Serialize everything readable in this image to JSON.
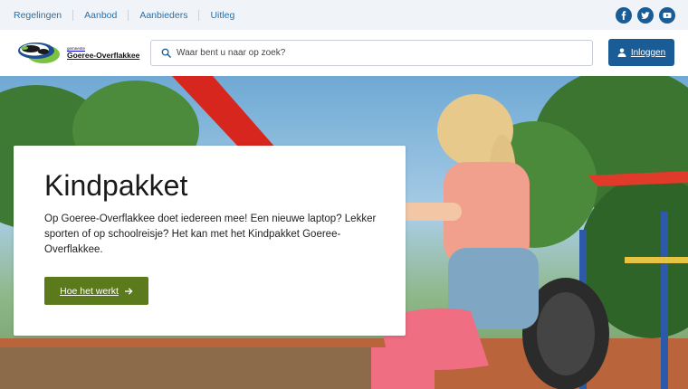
{
  "topnav": {
    "items": [
      "Regelingen",
      "Aanbod",
      "Aanbieders",
      "Uitleg"
    ]
  },
  "social": {
    "icons": [
      "facebook-icon",
      "twitter-icon",
      "youtube-icon"
    ]
  },
  "logo": {
    "small_text": "gemeente",
    "main_text": "Goeree-Overflakkee"
  },
  "search": {
    "placeholder": "Waar bent u naar op zoek?"
  },
  "header": {
    "login_label": "Inloggen"
  },
  "hero": {
    "title": "Kindpakket",
    "description": "Op Goeree-Overflakkee doet iedereen mee! Een nieuwe laptop? Lekker sporten of op schoolreisje? Het kan met het Kindpakket Goeree-Overflakkee.",
    "cta_label": "Hoe het werkt"
  },
  "colors": {
    "brand_blue": "#1a5d96",
    "cta_green": "#5b7a1b",
    "topbar_bg": "#f0f4f8"
  }
}
